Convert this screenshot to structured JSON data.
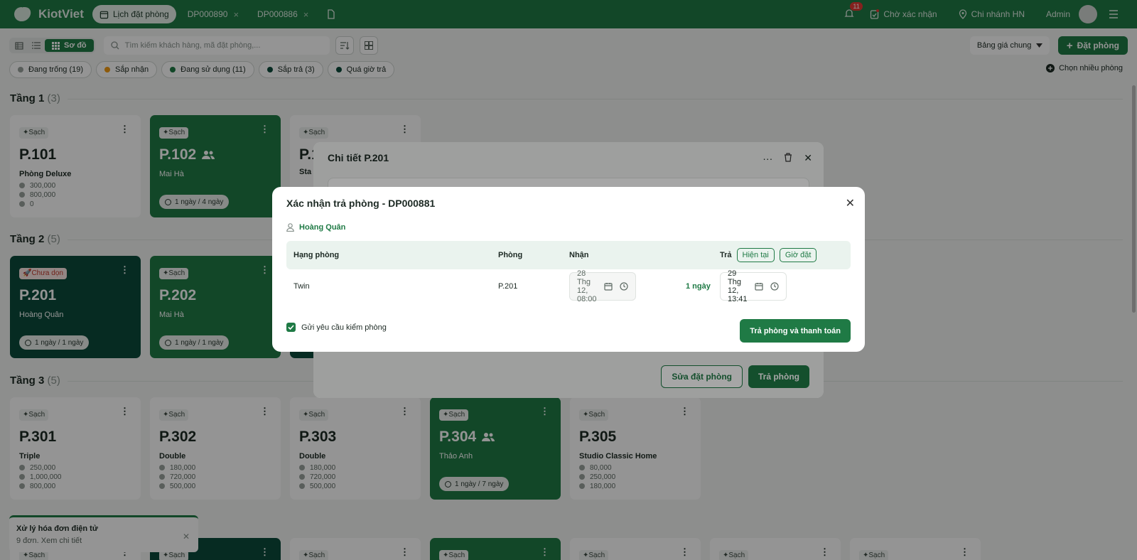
{
  "app": {
    "logo_text": "KiotViet"
  },
  "topbar": {
    "tabs": [
      {
        "label": "Lịch đặt phòng"
      },
      {
        "label": "DP000890"
      },
      {
        "label": "DP000886"
      }
    ],
    "notification_count": "11",
    "pending_label": "Chờ xác nhận",
    "branch_label": "Chi nhánh HN",
    "user_label": "Admin"
  },
  "toolbar": {
    "view_active_label": "Sơ đồ",
    "search_placeholder": "Tìm kiếm khách hàng, mã đặt phòng,...",
    "price_select": "Bảng giá chung",
    "book_button": "Đặt phòng",
    "multi_select": "Chọn nhiều phòng"
  },
  "filters": [
    {
      "label": "Đang trống (19)",
      "color": "#9aa39e"
    },
    {
      "label": "Sắp nhận",
      "color": "#f39c12"
    },
    {
      "label": "Đang sử dụng (11)",
      "color": "#1f7a45"
    },
    {
      "label": "Sắp trả (3)",
      "color": "#0b4a3b"
    },
    {
      "label": "Quá giờ trả",
      "color": "#0b4a3b"
    }
  ],
  "floors": [
    {
      "name": "Tầng 1",
      "count": "(3)"
    },
    {
      "name": "Tầng 2",
      "count": "(5)"
    },
    {
      "name": "Tầng 3",
      "count": "(5)"
    }
  ],
  "rooms": {
    "p101": {
      "status": "Sạch",
      "no": "P.101",
      "type": "Phòng Deluxe",
      "p1": "300,000",
      "p2": "800,000",
      "p3": "0"
    },
    "p102": {
      "status": "Sạch",
      "no": "P.102",
      "guest": "Mai Hà",
      "duration": "1 ngày / 4 ngày"
    },
    "p103": {
      "status": "Sạch",
      "no": "P.1",
      "type": "Sta"
    },
    "p201": {
      "status": "Chưa dọn",
      "no": "P.201",
      "guest": "Hoàng Quân",
      "duration": "1 ngày / 1 ngày"
    },
    "p202": {
      "status": "Sạch",
      "no": "P.202",
      "guest": "Mai Hà",
      "duration": "1 ngày / 1 ngày"
    },
    "p301": {
      "status": "Sạch",
      "no": "P.301",
      "type": "Triple",
      "p1": "250,000",
      "p2": "1,000,000",
      "p3": "800,000"
    },
    "p302": {
      "status": "Sạch",
      "no": "P.302",
      "type": "Double",
      "p1": "180,000",
      "p2": "720,000",
      "p3": "500,000"
    },
    "p303": {
      "status": "Sạch",
      "no": "P.303",
      "type": "Double",
      "p1": "180,000",
      "p2": "720,000",
      "p3": "500,000"
    },
    "p304": {
      "status": "Sạch",
      "no": "P.304",
      "guest": "Thảo Anh",
      "duration": "1 ngày / 7 ngày"
    },
    "p305": {
      "status": "Sạch",
      "no": "P.305",
      "type": "Studio Classic Home",
      "p1": "80,000",
      "p2": "250,000",
      "p3": "180,000"
    },
    "row4": {
      "status": "Sạch"
    }
  },
  "toast": {
    "title": "Xử lý hóa đơn điện tử",
    "body": "9 đơn. Xem chi tiết"
  },
  "detail_modal": {
    "title": "Chi tiết P.201",
    "edit_button": "Sửa đặt phòng",
    "checkout_button": "Trả phòng"
  },
  "confirm_modal": {
    "title": "Xác nhận trả phòng - DP000881",
    "guest": "Hoàng Quân",
    "headers": {
      "room_type": "Hạng phòng",
      "room": "Phòng",
      "checkin": "Nhận",
      "checkout": "Trả",
      "now": "Hiện tại",
      "booked": "Giờ đặt"
    },
    "row": {
      "room_type": "Twin",
      "room": "P.201",
      "checkin": "28 Thg 12, 08:00",
      "duration": "1 ngày",
      "checkout": "29 Thg 12, 13:41"
    },
    "checkbox_label": "Gửi yêu cầu kiểm phòng",
    "submit": "Trả phòng và thanh toán"
  }
}
